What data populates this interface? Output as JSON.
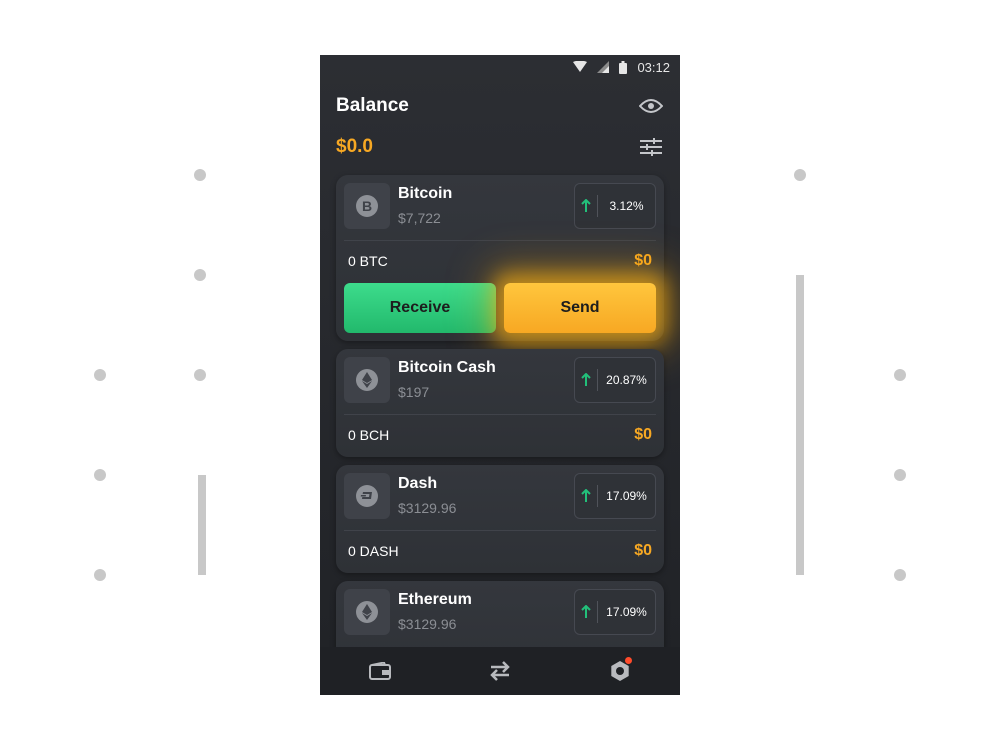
{
  "status_bar": {
    "time": "03:12"
  },
  "header": {
    "title": "Balance",
    "visibility_icon": "eye-icon",
    "filter_icon": "sliders-icon"
  },
  "balance": {
    "total": "$0.0"
  },
  "colors": {
    "accent": "#f7a823",
    "positive": "#22c07a",
    "receive": "#2ecc80",
    "background": "#26282c"
  },
  "coins": [
    {
      "name": "Bitcoin",
      "price": "$7,722",
      "change": "3.12%",
      "holding": "0 BTC",
      "fiat": "$0",
      "icon": "bitcoin-icon"
    },
    {
      "name": "Bitcoin Cash",
      "price": "$197",
      "change": "20.87%",
      "holding": "0 BCH",
      "fiat": "$0",
      "icon": "ethereum-icon"
    },
    {
      "name": "Dash",
      "price": "$3129.96",
      "change": "17.09%",
      "holding": "0 DASH",
      "fiat": "$0",
      "icon": "dash-icon"
    },
    {
      "name": "Ethereum",
      "price": "$3129.96",
      "change": "17.09%",
      "icon": "ethereum-icon"
    }
  ],
  "actions": {
    "receive_label": "Receive",
    "send_label": "Send"
  },
  "bottom_nav": [
    {
      "icon": "wallet-icon"
    },
    {
      "icon": "exchange-icon"
    },
    {
      "icon": "settings-icon",
      "has_notification": true
    }
  ]
}
